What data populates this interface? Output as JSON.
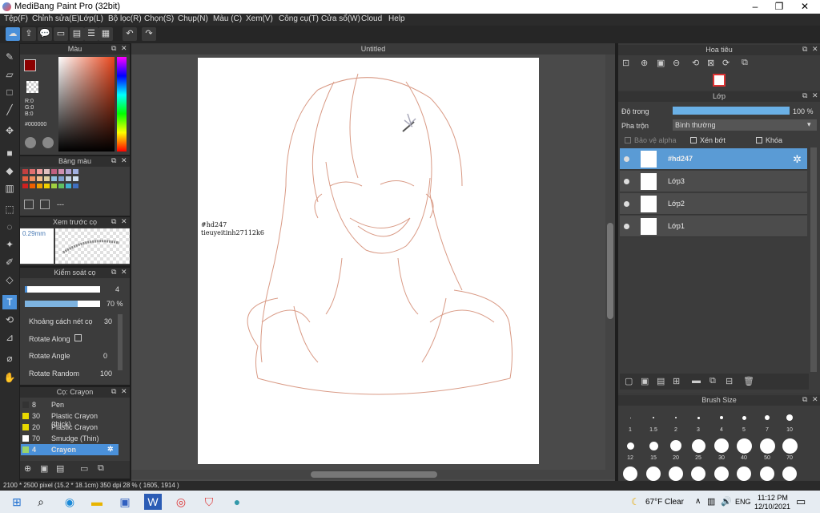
{
  "app": {
    "title": "MediBang Paint Pro (32bit)",
    "doc_tab": "Untitled"
  },
  "menu": [
    "Tệp(F)",
    "Chỉnh sửa(E)",
    "Lớp(L)",
    "Bộ lọc(R)",
    "Chọn(S)",
    "Chụp(N)",
    "Màu (C)",
    "Xem(V)",
    "Công cụ(T)",
    "Cửa sổ(W)",
    "Cloud",
    "Help"
  ],
  "color_panel": {
    "title": "Màu",
    "r": "R:0",
    "g": "G:0",
    "b": "B:0",
    "hex": "#000000",
    "main_color": "#8b0000"
  },
  "palette_panel": {
    "title": "Bảng màu",
    "dash": "---"
  },
  "preview_panel": {
    "title": "Xem trước cọ",
    "size": "0.29mm"
  },
  "brush_ctrl": {
    "title": "Kiểm soát cọ",
    "size_value": "4",
    "opacity_value": "70 %",
    "spacing_label": "Khoảng cách nét cọ",
    "spacing_value": "30",
    "rotate_along_label": "Rotate Along",
    "rotate_angle_label": "Rotate Angle",
    "rotate_angle_value": "0",
    "rotate_random_label": "Rotate Random",
    "rotate_random_value": "100",
    "opacity_level": 0.7
  },
  "brush_list": {
    "title": "Cọ: Crayon",
    "items": [
      {
        "num": "8",
        "name": "Pen",
        "color": "#333333"
      },
      {
        "num": "30",
        "name": "Plastic Crayon (thick)",
        "color": "#e8d800"
      },
      {
        "num": "20",
        "name": "Plastic Crayon",
        "color": "#e8d800"
      },
      {
        "num": "70",
        "name": "Smudge (Thin)",
        "color": "#ffffff"
      },
      {
        "num": "4",
        "name": "Crayon",
        "color": "#9bd36a"
      }
    ]
  },
  "canvas": {
    "watermark_line1": "#hd247",
    "watermark_line2": "tieuyeitinh27112k6"
  },
  "navigator": {
    "title": "Hoa tiêu"
  },
  "layer_panel": {
    "title": "Lớp",
    "opacity_label": "Độ trong",
    "opacity_value": "100 %",
    "blend_label": "Pha trộn",
    "blend_value": "Bình thường",
    "protect_alpha": "Bảo vệ alpha",
    "clipping": "Xén bớt",
    "lock": "Khóa",
    "layers": [
      "#hd247",
      "Lớp3",
      "Lớp2",
      "Lớp1"
    ]
  },
  "brush_size": {
    "title": "Brush Size",
    "row1": [
      "1",
      "1.5",
      "2",
      "3",
      "4",
      "5",
      "7",
      "10"
    ],
    "row2": [
      "12",
      "15",
      "20",
      "25",
      "30",
      "40",
      "50",
      "70"
    ]
  },
  "status": {
    "text": "2100 * 2500 pixel  (15.2 * 18.1cm)  350 dpi  28 %  ( 1605, 1914 )"
  },
  "taskbar": {
    "weather": "67°F  Clear",
    "lang": "ENG",
    "time": "11:12 PM",
    "date": "12/10/2021"
  }
}
